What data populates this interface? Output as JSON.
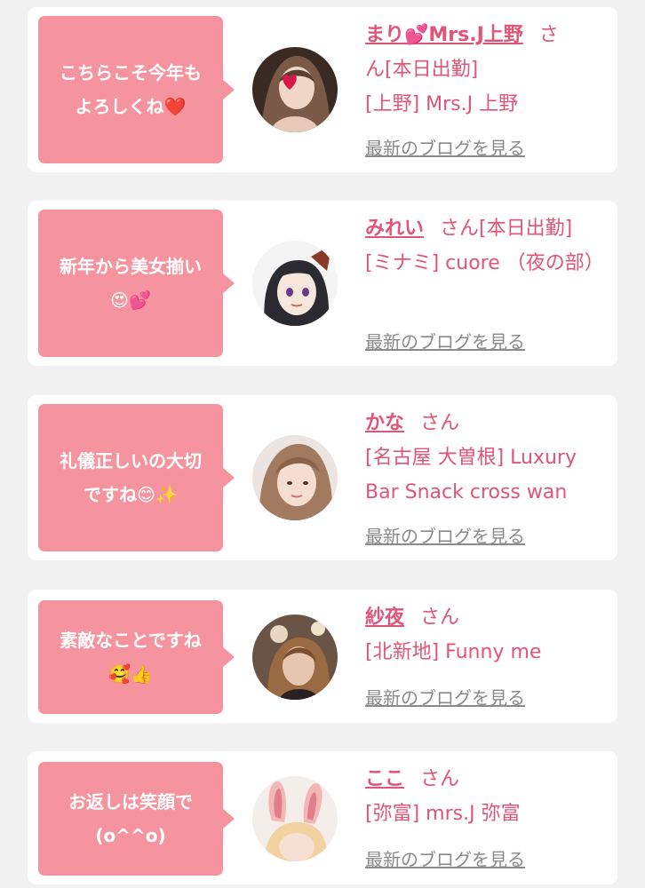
{
  "cards": [
    {
      "message": "こちらこそ今年も\nよろしくね❤️",
      "name": "まり💕Mrs.J上野",
      "suffix": "さ",
      "status_line": "ん[本日出勤]",
      "shop": "[上野] Mrs.J 上野",
      "blog_link": "最新のブログを見る",
      "avatar_icon": "profile-photo"
    },
    {
      "message": "新年から美女揃い\n😍💕",
      "name": "みれい",
      "suffix": "さん[本日出勤]",
      "status_line": "",
      "shop": "[ミナミ] cuore （夜の部）",
      "blog_link": "最新のブログを見る",
      "avatar_icon": "anime-avatar"
    },
    {
      "message": "礼儀正しいの大切\nですね😊✨",
      "name": "かな",
      "suffix": "さん",
      "status_line": "",
      "shop": "[名古屋 大曽根] Luxury Bar Snack cross wan",
      "blog_link": "最新のブログを見る",
      "avatar_icon": "profile-photo"
    },
    {
      "message": "素敵なことですね\n🥰👍",
      "name": "紗夜",
      "suffix": "さん",
      "status_line": "",
      "shop": "[北新地] Funny me",
      "blog_link": "最新のブログを見る",
      "avatar_icon": "profile-photo"
    },
    {
      "message": "お返しは笑顔で\n(o^^o)",
      "name": "ここ",
      "suffix": "さん",
      "status_line": "",
      "shop": "[弥富] mrs.J 弥富",
      "blog_link": "最新のブログを見る",
      "avatar_icon": "bunny-ears-photo"
    }
  ],
  "colors": {
    "page_background": "#f1f1f1",
    "card_background": "#ffffff",
    "bubble_pink": "#f5939f",
    "name_pink": "#e05577",
    "link_gray": "#8a8a8a"
  }
}
